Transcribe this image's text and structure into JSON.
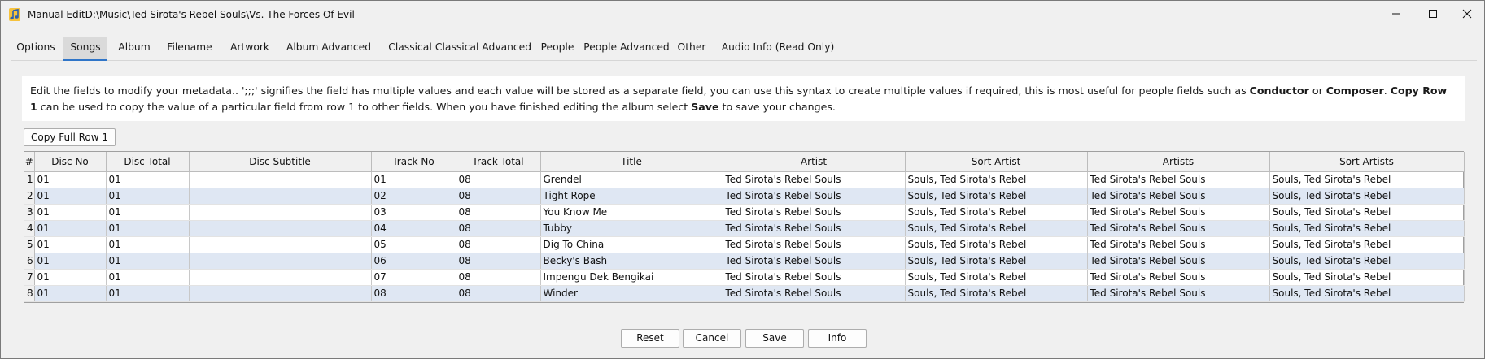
{
  "window": {
    "title": "Manual EditD:\\Music\\Ted Sirota's Rebel Souls\\Vs. The Forces Of Evil",
    "controls": {
      "minimize_icon": "minimize-icon",
      "maximize_icon": "maximize-icon",
      "close_icon": "close-icon"
    }
  },
  "tabs": [
    {
      "label": "Options"
    },
    {
      "label": "Songs",
      "active": true
    },
    {
      "label": "Album"
    },
    {
      "label": "Filename"
    },
    {
      "label": "Artwork"
    },
    {
      "label": "Album Advanced"
    },
    {
      "label": "Classical"
    },
    {
      "label": "Classical Advanced"
    },
    {
      "label": "People"
    },
    {
      "label": "People Advanced"
    },
    {
      "label": "Other"
    },
    {
      "label": "Audio Info (Read Only)"
    }
  ],
  "info": {
    "t1": "Edit the fields to modify your metadata.. ';;;' signifies the field has multiple values and each value will be stored as a separate field, you can use this syntax to create multiple values if required, this is most useful for people fields such as ",
    "b1": "Conductor",
    "t2": " or ",
    "b2": "Composer",
    "t3": ". ",
    "b3": "Copy Row 1",
    "t4": " can be used to copy the value of a particular field from row 1 to other fields. When you have finished editing the album select ",
    "b4": "Save",
    "t5": " to save your changes."
  },
  "copy_button": "Copy Full Row 1",
  "table": {
    "columns": [
      "#",
      "Disc No",
      "Disc Total",
      "Disc Subtitle",
      "Track No",
      "Track Total",
      "Title",
      "Artist",
      "Sort Artist",
      "Artists",
      "Sort Artists"
    ],
    "rows": [
      [
        "1",
        "01",
        "01",
        "",
        "01",
        "08",
        "Grendel",
        "Ted Sirota's Rebel Souls",
        "Souls, Ted Sirota's Rebel",
        "Ted Sirota's Rebel Souls",
        "Souls, Ted Sirota's Rebel"
      ],
      [
        "2",
        "01",
        "01",
        "",
        "02",
        "08",
        "Tight Rope",
        "Ted Sirota's Rebel Souls",
        "Souls, Ted Sirota's Rebel",
        "Ted Sirota's Rebel Souls",
        "Souls, Ted Sirota's Rebel"
      ],
      [
        "3",
        "01",
        "01",
        "",
        "03",
        "08",
        "You Know Me",
        "Ted Sirota's Rebel Souls",
        "Souls, Ted Sirota's Rebel",
        "Ted Sirota's Rebel Souls",
        "Souls, Ted Sirota's Rebel"
      ],
      [
        "4",
        "01",
        "01",
        "",
        "04",
        "08",
        "Tubby",
        "Ted Sirota's Rebel Souls",
        "Souls, Ted Sirota's Rebel",
        "Ted Sirota's Rebel Souls",
        "Souls, Ted Sirota's Rebel"
      ],
      [
        "5",
        "01",
        "01",
        "",
        "05",
        "08",
        "Dig To China",
        "Ted Sirota's Rebel Souls",
        "Souls, Ted Sirota's Rebel",
        "Ted Sirota's Rebel Souls",
        "Souls, Ted Sirota's Rebel"
      ],
      [
        "6",
        "01",
        "01",
        "",
        "06",
        "08",
        "Becky's Bash",
        "Ted Sirota's Rebel Souls",
        "Souls, Ted Sirota's Rebel",
        "Ted Sirota's Rebel Souls",
        "Souls, Ted Sirota's Rebel"
      ],
      [
        "7",
        "01",
        "01",
        "",
        "07",
        "08",
        "Impengu Dek Bengikai",
        "Ted Sirota's Rebel Souls",
        "Souls, Ted Sirota's Rebel",
        "Ted Sirota's Rebel Souls",
        "Souls, Ted Sirota's Rebel"
      ],
      [
        "8",
        "01",
        "01",
        "",
        "08",
        "08",
        "Winder",
        "Ted Sirota's Rebel Souls",
        "Souls, Ted Sirota's Rebel",
        "Ted Sirota's Rebel Souls",
        "Souls, Ted Sirota's Rebel"
      ]
    ]
  },
  "buttons": {
    "reset": "Reset",
    "cancel": "Cancel",
    "save": "Save",
    "info": "Info"
  },
  "colors": {
    "accent": "#2f75c8",
    "alt_row": "#dfe7f3",
    "background": "#f0f0f0"
  }
}
